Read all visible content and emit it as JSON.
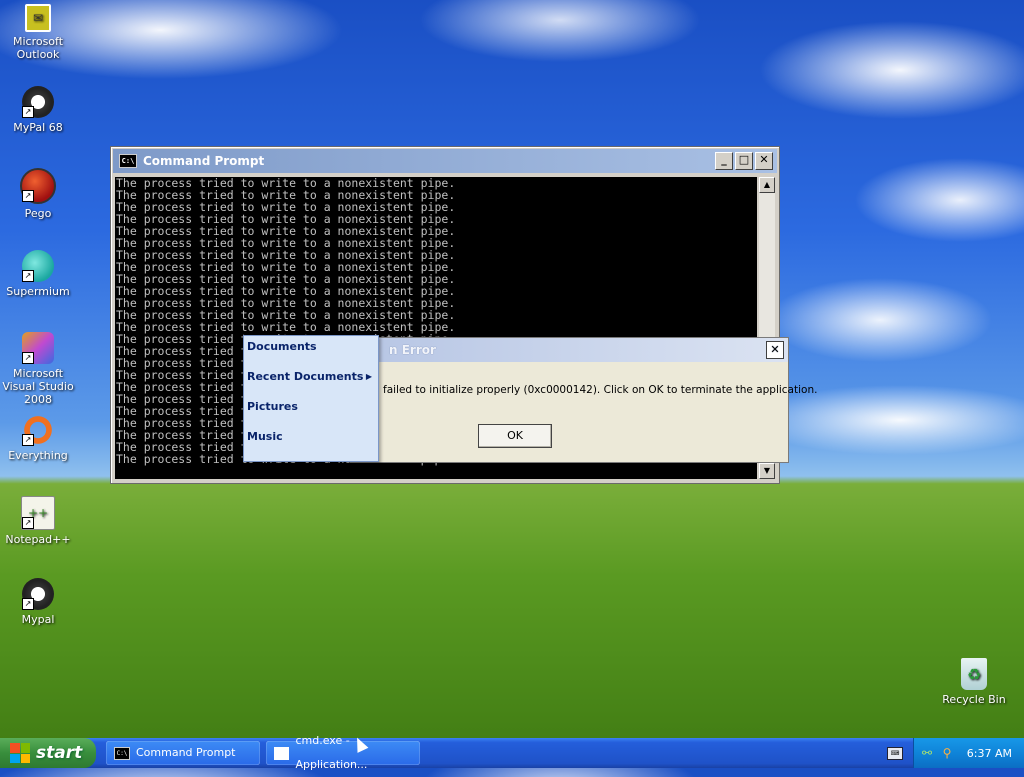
{
  "desktop_icons": [
    {
      "label": "Microsoft Outlook",
      "icon": "outlook-icon"
    },
    {
      "label": "MyPal 68",
      "icon": "mypal-icon"
    },
    {
      "label": "Pego",
      "icon": "pego-icon"
    },
    {
      "label": "Supermium",
      "icon": "supermium-icon"
    },
    {
      "label": "Microsoft Visual Studio 2008",
      "icon": "visual-studio-icon"
    },
    {
      "label": "Everything",
      "icon": "everything-icon"
    },
    {
      "label": "Notepad++",
      "icon": "notepadpp-icon"
    },
    {
      "label": "Mypal",
      "icon": "mypal-icon"
    },
    {
      "label": "Recycle Bin",
      "icon": "recycle-bin-icon"
    }
  ],
  "cmd_window": {
    "title": "Command Prompt",
    "icon_text": "C:\\",
    "minimize": "_",
    "maximize": "□",
    "close": "✕",
    "line": "The process tried to write to a nonexistent pipe.",
    "line_count": 24
  },
  "error_dialog": {
    "title": "n Error",
    "message": "failed to initialize properly (0xc0000142). Click on OK to terminate the application.",
    "ok_label": "OK",
    "close": "✕"
  },
  "menu": {
    "items": [
      {
        "label": "Documents",
        "submenu": false
      },
      {
        "label": "Recent Documents",
        "submenu": true
      },
      {
        "label": "Pictures",
        "submenu": false
      },
      {
        "label": "Music",
        "submenu": false
      }
    ],
    "sub_arrow": "▶"
  },
  "taskbar": {
    "start_label": "start",
    "tasks": [
      {
        "label": "Command Prompt",
        "icon_text": "C:\\"
      },
      {
        "label": "cmd.exe - Application..."
      }
    ],
    "keyboard_icon": "⌨",
    "clock": "6:37 AM"
  },
  "colors": {
    "taskbar_blue": "#245edb",
    "start_green": "#388e3c",
    "tray_blue": "#0f84d9",
    "menu_bg": "#d8e6f8"
  }
}
